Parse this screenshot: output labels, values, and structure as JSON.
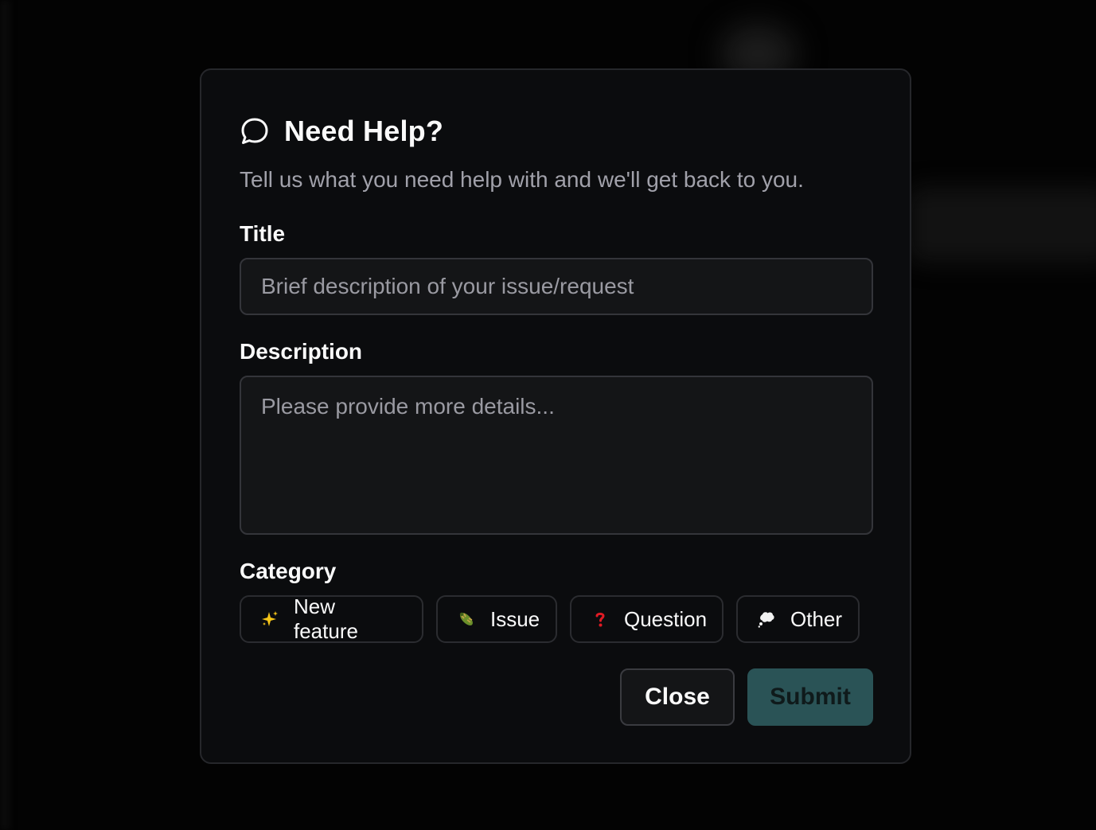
{
  "dialog": {
    "title": "Need Help?",
    "title_icon": "chat-bubble-icon",
    "subtitle": "Tell us what you need help with and we'll get back to you."
  },
  "form": {
    "title_label": "Title",
    "title_placeholder": "Brief description of your issue/request",
    "title_value": "",
    "description_label": "Description",
    "description_placeholder": "Please provide more details...",
    "description_value": "",
    "category_label": "Category",
    "categories": [
      {
        "label": "New feature",
        "icon": "sparkles-icon"
      },
      {
        "label": "Issue",
        "icon": "bug-icon"
      },
      {
        "label": "Question",
        "icon": "question-mark-icon"
      },
      {
        "label": "Other",
        "icon": "thought-bubble-icon"
      }
    ]
  },
  "actions": {
    "close_label": "Close",
    "submit_label": "Submit"
  },
  "colors": {
    "background": "#030303",
    "dialog": "#0b0c0e",
    "input": "#141517",
    "submit_disabled": "#2a5356",
    "text": "#fafafa",
    "muted": "#a1a1aa"
  }
}
